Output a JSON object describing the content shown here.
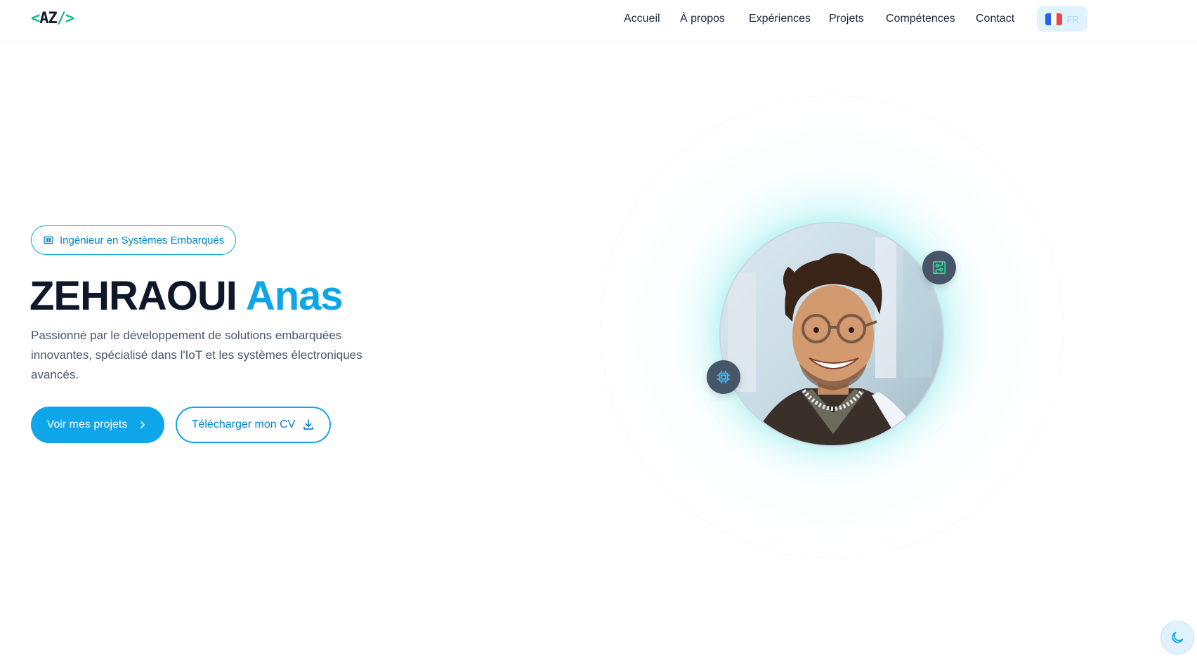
{
  "nav": {
    "logo": {
      "open": "<",
      "text": "AZ",
      "close": "/>"
    },
    "links": [
      "Accueil",
      "À propos",
      "Expériences",
      "Projets",
      "Compétences",
      "Contact"
    ],
    "lang": {
      "code": "FR",
      "flag_colors": [
        "#2563eb",
        "#ffffff",
        "#ef4444"
      ]
    }
  },
  "hero": {
    "badge": "Ingénieur en Systèmes Embarqués",
    "last_name": "ZEHRAOUI",
    "first_name": "Anas",
    "description": "Passionné par le développement de solutions embarquées innovantes, spécialisé dans l'IoT et les systèmes électroniques avancés.",
    "primary_button": "Voir mes projets",
    "secondary_button": "Télécharger mon CV"
  },
  "colors": {
    "accent": "#0ea5e9",
    "brand_green": "#10b981",
    "text_dark": "#0f172a"
  },
  "icons": {
    "badge": "chip-icon",
    "primary_button": "chevron-right-icon",
    "secondary_button": "download-icon",
    "float_top": "circuit-board-icon",
    "float_left": "cpu-icon",
    "theme_toggle": "moon-icon"
  }
}
